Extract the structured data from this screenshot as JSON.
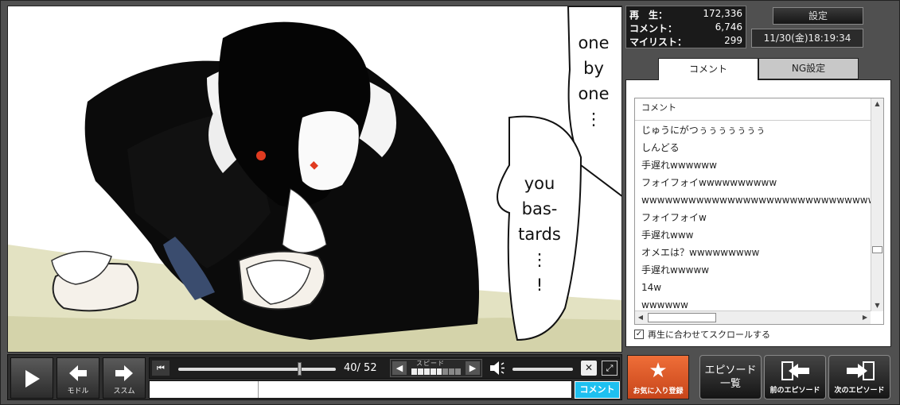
{
  "manga_page": {
    "bubble1_lines": [
      "one",
      "by",
      "one",
      "⋮"
    ],
    "bubble2_lines": [
      "you",
      "bas-",
      "tards",
      "⋮",
      "!"
    ]
  },
  "player": {
    "back_label": "モドル",
    "next_label": "ススム",
    "current_page": "40",
    "total_pages": "52",
    "page_counter": "40/ 52",
    "seek_progress": 0.77,
    "speed_label": "スピード",
    "speed_level": 5,
    "speed_max": 8,
    "volume_level": 0.0,
    "comment_submit_label": "コメント",
    "command_placeholder": "",
    "comment_placeholder": ""
  },
  "stats": {
    "views_label": "再　生：",
    "views": "172,336",
    "comments_label": "コメント：",
    "comments": "6,746",
    "mylist_label": "マイリスト：",
    "mylist": "299"
  },
  "settings_label": "設定",
  "datetime": "11/30(金)18:19:34",
  "tabs": {
    "comment": "コメント",
    "ng": "NG設定"
  },
  "comment_list": {
    "header": "コメント",
    "rows": [
      "じゅうにがつぅぅぅぅぅぅぅ",
      "しんどる",
      "手遅れwwwwww",
      "フォイフォイwwwwwwwwww",
      "wwwwwwwwwwwwwwwwwwwwwwwwwwwwww",
      "フォイフォイw",
      "手遅れwww",
      "オメエは？wwwwwwwww",
      "手遅れwwwww",
      "14w",
      "wwwwww"
    ],
    "autoscroll_label": "再生に合わせてスクロールする",
    "autoscroll_checked": true
  },
  "buttons": {
    "favorite": "お気に入り登録",
    "episode_list": "エピソード\n一覧",
    "prev_episode": "前のエピソード",
    "next_episode": "次のエピソード"
  },
  "colors": {
    "favorite_bg": "#e25a26",
    "comment_submit_bg": "#1ec0f0",
    "panel_bg": "#505050"
  }
}
